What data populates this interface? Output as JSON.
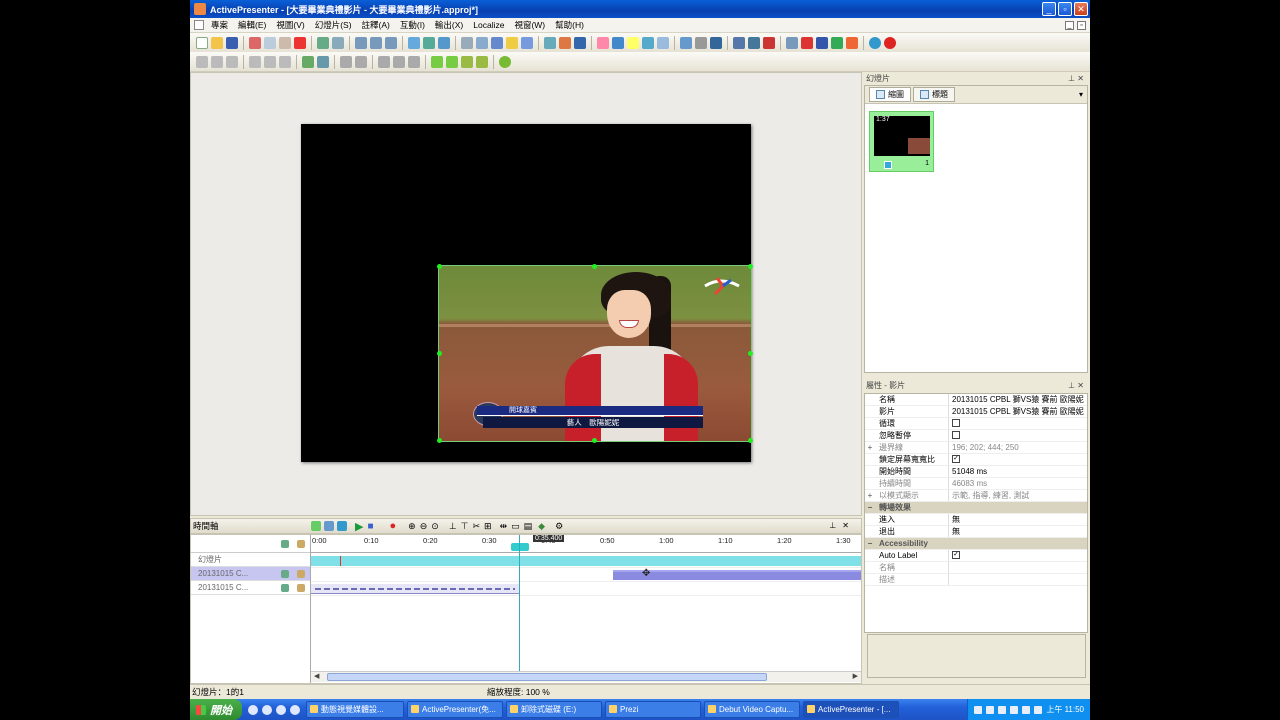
{
  "window": {
    "title": "ActivePresenter - [大要畢業典禮影片 - 大要畢業典禮影片.approj*]"
  },
  "menu": [
    "專案",
    "編輯(E)",
    "視圖(V)",
    "幻燈片(S)",
    "註釋(A)",
    "互動(I)",
    "輸出(X)",
    "Localize",
    "視窗(W)",
    "幫助(H)"
  ],
  "video_overlay": {
    "banner_title": "開球嘉賓",
    "banner_name": "藝人　歐陽妮妮"
  },
  "slides_panel": {
    "header": "幻燈片",
    "tabs": [
      "縮圖",
      "標題"
    ],
    "thumbnail": {
      "time": "1:37",
      "number": "1"
    }
  },
  "properties_panel": {
    "header": "屬性 - 影片",
    "rows": [
      {
        "name": "名稱",
        "value": "20131015 CPBL 獅VS猿 賽前 歐陽妮",
        "dim": false
      },
      {
        "name": "影片",
        "value": "20131015 CPBL 獅VS猿 賽前 歐陽妮",
        "dim": false
      },
      {
        "name": "循環",
        "value": "",
        "check": false,
        "dim": false
      },
      {
        "name": "忽略暫停",
        "value": "",
        "check": false,
        "dim": false
      },
      {
        "name": "邊界線",
        "value": "196; 202; 444; 250",
        "dim": true,
        "expand": "+"
      },
      {
        "name": "鎖定屏幕寬寬比",
        "value": "",
        "check": true,
        "dim": false
      },
      {
        "name": "開始時間",
        "value": "51048 ms",
        "dim": false
      },
      {
        "name": "持續時間",
        "value": "46083 ms",
        "dim": true
      },
      {
        "name": "以模式顯示",
        "value": "示範, 指導, 練習, 測試",
        "dim": true,
        "expand": "+"
      }
    ],
    "cat_effects": "轉場效果",
    "effects": [
      {
        "name": "進入",
        "value": "無"
      },
      {
        "name": "退出",
        "value": "無"
      }
    ],
    "cat_access": "Accessibility",
    "access": [
      {
        "name": "Auto Label",
        "value": "",
        "check": true,
        "dim": false
      },
      {
        "name": "名稱",
        "value": "",
        "dim": true
      },
      {
        "name": "描述",
        "value": "",
        "dim": true
      }
    ]
  },
  "timeline": {
    "title": "時間軸",
    "ruler_labels": [
      "0:00",
      "0:10",
      "0:20",
      "0:30",
      "0:40",
      "0:50",
      "1:00",
      "1:10",
      "1:20",
      "1:30"
    ],
    "playhead": "0:35.400",
    "tracks": [
      "幻燈片",
      "20131015 C...",
      "20131015 C..."
    ]
  },
  "status": {
    "slide_info": "幻燈片：1的1",
    "zoom": "縮放程度: 100 %"
  },
  "taskbar": {
    "start": "開始",
    "tasks": [
      "動態視覺媒體設...",
      "ActivePresenter(免...",
      "卸除式磁碟 (E:)",
      "Prezi",
      "Debut Video Captu...",
      "ActivePresenter - [..."
    ],
    "clock": "上午 11:50"
  },
  "colors": {
    "title_bar": "#0a5fd8",
    "selection": "#c6c6f0",
    "track_bar": "#8a8ae0",
    "slide_track": "#7fe0e8",
    "playhead": "#33aabb"
  }
}
